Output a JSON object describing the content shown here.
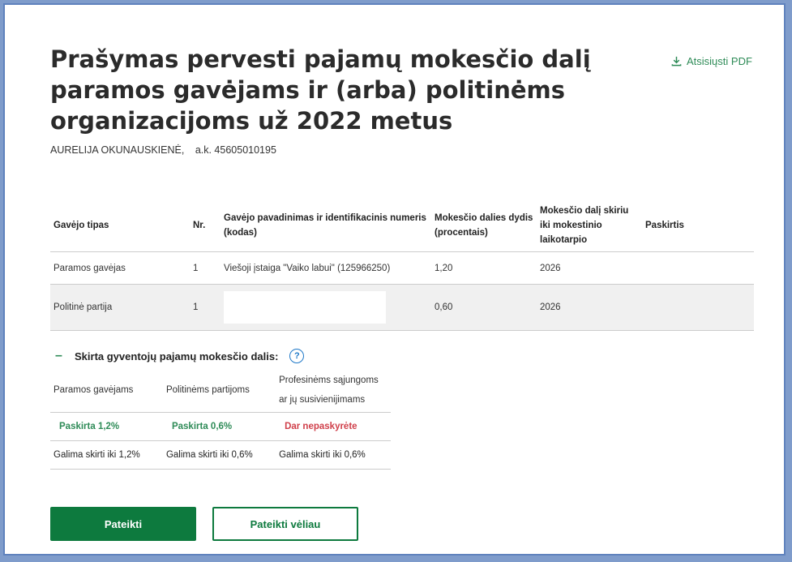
{
  "header": {
    "title": "Prašymas pervesti pajamų mokesčio dalį paramos gavėjams ir (arba) politinėms organizacijoms už 2022 metus",
    "pdf_label": "Atsisiųsti PDF",
    "person_name": "AURELIJA OKUNAUSKIENĖ,",
    "personal_code": "a.k.  45605010195"
  },
  "table": {
    "headers": {
      "type": "Gavėjo tipas",
      "nr": "Nr.",
      "name": "Gavėjo pavadinimas ir identifikacinis numeris (kodas)",
      "size": "Mokesčio dalies dydis (procentais)",
      "period": "Mokesčio dalį skiriu iki mokestinio laikotarpio",
      "purpose": "Paskirtis"
    },
    "rows": [
      {
        "type": "Paramos gavėjas",
        "nr": "1",
        "name": "Viešoji įstaiga \"Vaiko labui\" (125966250)",
        "size": "1,20",
        "period": "2026",
        "purpose": ""
      },
      {
        "type": "Politinė partija",
        "nr": "1",
        "name": "",
        "size": "0,60",
        "period": "2026",
        "purpose": ""
      }
    ]
  },
  "summary": {
    "title": "Skirta gyventojų pajamų mokesčio dalis:",
    "toggle_symbol": "–",
    "help_symbol": "?",
    "headers": [
      "Paramos gavėjams",
      "Politinėms partijoms",
      "Profesinėms sąjungoms ar jų susivienijimams"
    ],
    "status": [
      "Paskirta 1,2%",
      "Paskirta 0,6%",
      "Dar nepaskyrėte"
    ],
    "limits": [
      "Galima skirti iki 1,2%",
      "Galima skirti iki 0,6%",
      "Galima skirti iki 0,6%"
    ]
  },
  "actions": {
    "submit": "Pateikti",
    "submit_later": "Pateikti vėliau"
  },
  "colors": {
    "accent": "#0d7a3e",
    "link": "#2e8b57",
    "warning": "#d0404b",
    "frame": "#5f82bd"
  }
}
